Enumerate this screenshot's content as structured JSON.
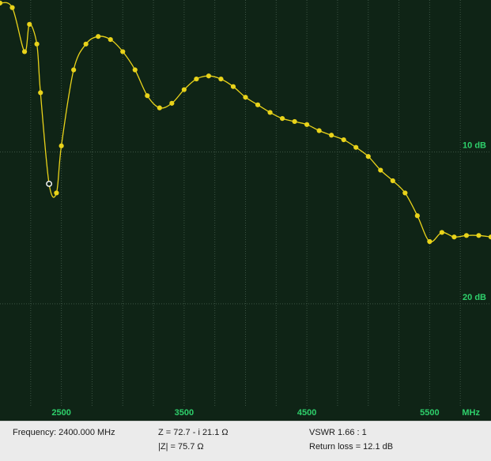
{
  "colors": {
    "background": "#0f2416",
    "grid": "#3c5444",
    "trace": "#e9d31a",
    "label": "#2ed06b"
  },
  "status": {
    "frequency": "Frequency: 2400.000 MHz",
    "impedance": "Z = 72.7 - i 21.1 Ω",
    "abs_impedance": "|Z| = 75.7 Ω",
    "vswr": "VSWR 1.66 : 1",
    "return_loss": "Return loss = 12.1 dB"
  },
  "chart_data": {
    "type": "line",
    "xunit": "MHz",
    "x_ticks": [
      2500,
      3500,
      4500,
      5500
    ],
    "x_tick_labels": [
      "2500",
      "3500",
      "4500",
      "5500"
    ],
    "y_ticks": [
      10,
      20
    ],
    "y_tick_labels": [
      "10 dB",
      "20 dB"
    ],
    "xlim": [
      2000,
      6000
    ],
    "ylim": [
      0,
      26.5
    ],
    "y_inverted": true,
    "grid": true,
    "marker": {
      "x": 2400,
      "y": 12.1
    },
    "series": [
      {
        "x": [
          2000,
          2100,
          2200,
          2240,
          2300,
          2330,
          2400,
          2460,
          2500,
          2600,
          2700,
          2800,
          2900,
          3000,
          3100,
          3200,
          3300,
          3400,
          3500,
          3600,
          3700,
          3800,
          3900,
          4000,
          4100,
          4200,
          4300,
          4400,
          4500,
          4600,
          4700,
          4800,
          4900,
          5000,
          5100,
          5200,
          5300,
          5400,
          5500,
          5600,
          5700,
          5800,
          5900,
          6000
        ],
        "y": [
          0.2,
          0.5,
          3.4,
          1.6,
          2.9,
          6.1,
          12.1,
          12.7,
          9.6,
          4.6,
          2.9,
          2.4,
          2.6,
          3.4,
          4.6,
          6.3,
          7.1,
          6.8,
          5.9,
          5.2,
          5.0,
          5.2,
          5.7,
          6.4,
          6.9,
          7.4,
          7.8,
          8.0,
          8.2,
          8.6,
          8.9,
          9.2,
          9.7,
          10.3,
          11.2,
          11.9,
          12.7,
          14.2,
          15.9,
          15.3,
          15.6,
          15.5,
          15.5,
          15.6
        ]
      }
    ]
  }
}
